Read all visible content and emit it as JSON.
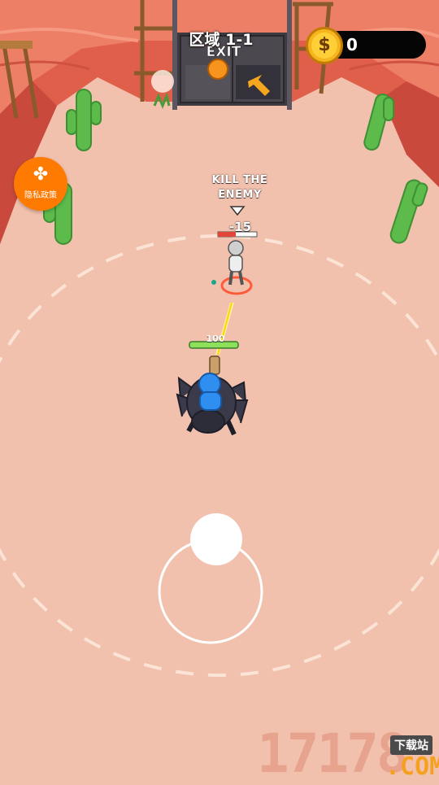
{
  "hud": {
    "level_title": "区域 1-1",
    "coin_count": "0",
    "coin_symbol": "$"
  },
  "privacy": {
    "label": "隐私政策",
    "icon": "clover-icon"
  },
  "gate": {
    "sign": "EXIT"
  },
  "objective": {
    "line1": "KILL THE",
    "line2": "ENEMY"
  },
  "combat": {
    "damage": "-15",
    "player_hp": "100"
  },
  "watermark": {
    "number": "17178",
    "tag": "下载站",
    "suffix": ".COM"
  },
  "colors": {
    "sand": "#f1c1ad",
    "canyon": "#e26a55",
    "accent_orange": "#ff7a00",
    "coin_gold": "#f6b51d",
    "cactus_green": "#5cbb4a",
    "player_blue": "#2f8ff0",
    "spider_dark": "#3a3a4a"
  }
}
